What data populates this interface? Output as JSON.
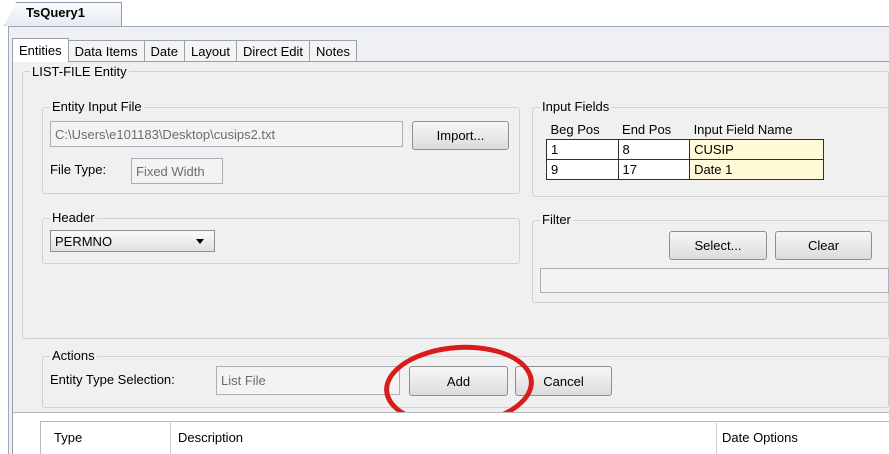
{
  "document_tab": {
    "title": "TsQuery1"
  },
  "tabs": [
    {
      "label": "Entities",
      "active": true
    },
    {
      "label": "Data Items"
    },
    {
      "label": "Date"
    },
    {
      "label": "Layout"
    },
    {
      "label": "Direct Edit"
    },
    {
      "label": "Notes"
    }
  ],
  "entity_group": {
    "title": "LIST-FILE Entity"
  },
  "entity_input_file": {
    "title": "Entity Input File",
    "path": "C:\\Users\\e101183\\Desktop\\cusips2.txt",
    "import_label": "Import...",
    "file_type_label": "File Type:",
    "file_type_value": "Fixed Width"
  },
  "input_fields": {
    "title": "Input Fields",
    "columns": [
      "Beg Pos",
      "End Pos",
      "Input Field Name"
    ],
    "rows": [
      {
        "beg": "1",
        "end": "8",
        "name": "CUSIP"
      },
      {
        "beg": "9",
        "end": "17",
        "name": "Date 1"
      }
    ]
  },
  "header": {
    "title": "Header",
    "selected": "PERMNO"
  },
  "filter": {
    "title": "Filter",
    "select_label": "Select...",
    "clear_label": "Clear"
  },
  "actions": {
    "title": "Actions",
    "entity_type_label": "Entity Type Selection:",
    "entity_type_value": "List File",
    "add_label": "Add",
    "cancel_label": "Cancel"
  },
  "list": {
    "columns": [
      "Type",
      "Description",
      "Date Options"
    ]
  },
  "colors": {
    "highlight_oval": "#d81c1c",
    "field_name_bg": "#fffbd8"
  }
}
